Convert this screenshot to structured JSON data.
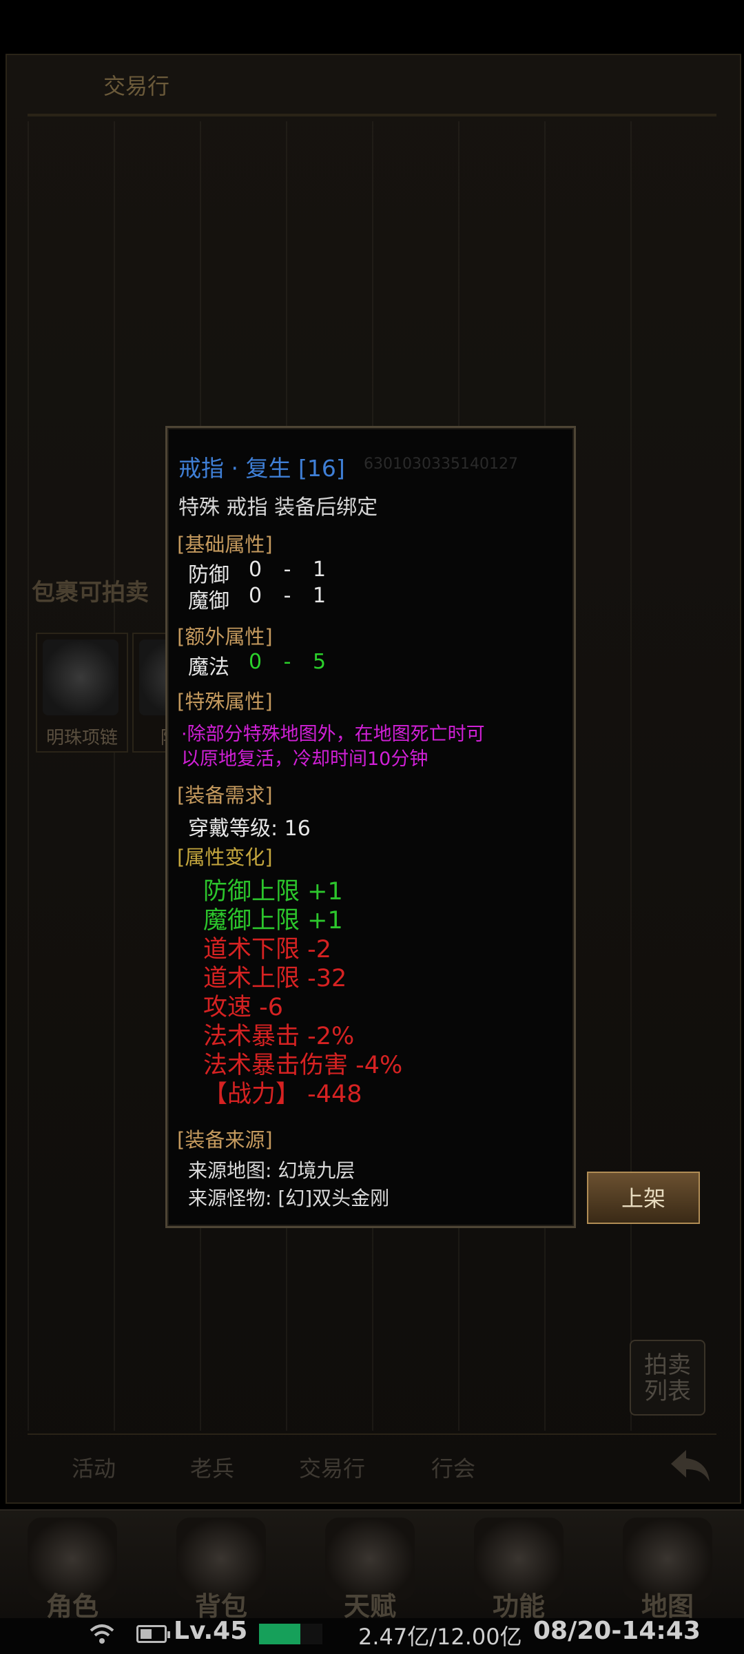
{
  "panel": {
    "title": "交易行",
    "bag_title": "包裹可拍卖",
    "items": [
      {
        "name": "明珠项链"
      },
      {
        "name": "降魔"
      }
    ],
    "auction_list_button": "拍卖\n列表",
    "listing_button": "上架",
    "tabs": [
      "活动",
      "老兵",
      "交易行",
      "行会"
    ]
  },
  "tooltip": {
    "title": "戒指 · 复生 [16]",
    "item_id": "6301030335140127",
    "subtitle": "特殊 戒指  装备后绑定",
    "base_header": "[基础属性]",
    "base_attrs": [
      {
        "label": "防御",
        "value": "0  -  1"
      },
      {
        "label": "魔御",
        "value": "0  -  1"
      }
    ],
    "extra_header": "[额外属性]",
    "extra_attrs": [
      {
        "label": "魔法",
        "value": "0  -  5"
      }
    ],
    "special_header": "[特殊属性]",
    "special_line1": "·除部分特殊地图外，在地图死亡时可",
    "special_line2": "以原地复活，冷却时间10分钟",
    "require_header": "[装备需求]",
    "require_text": "穿戴等级: 16",
    "change_header": "[属性变化]",
    "changes": [
      {
        "text": "防御上限  +1",
        "tone": "up"
      },
      {
        "text": "魔御上限  +1",
        "tone": "up"
      },
      {
        "text": "道术下限  -2",
        "tone": "down"
      },
      {
        "text": "道术上限  -32",
        "tone": "down"
      },
      {
        "text": "攻速  -6",
        "tone": "down"
      },
      {
        "text": "法术暴击  -2%",
        "tone": "down"
      },
      {
        "text": "法术暴击伤害  -4%",
        "tone": "down"
      },
      {
        "text": "【战力】 -448",
        "tone": "down"
      }
    ],
    "source_header": "[装备来源]",
    "source_map": "来源地图:   幻境九层",
    "source_monster": "来源怪物:   [幻]双头金刚"
  },
  "bottom_nav": [
    {
      "label": "角色",
      "icon": "hooded-character-icon"
    },
    {
      "label": "背包",
      "icon": "potion-bag-icon"
    },
    {
      "label": "天赋",
      "icon": "dragon-emblem-icon"
    },
    {
      "label": "功能",
      "icon": "anvil-icon"
    },
    {
      "label": "地图",
      "icon": "compass-icon"
    }
  ],
  "status": {
    "level": "Lv.45",
    "exp_fraction": 0.65,
    "gold": "2.47亿/12.00亿",
    "clock": "08/20-14:43"
  },
  "colors": {
    "title_blue": "#3f7fd6",
    "section_gold": "#c59a5e",
    "attr_green": "#2bd12b",
    "special_magenta": "#d020d6",
    "change_red": "#d62222"
  }
}
